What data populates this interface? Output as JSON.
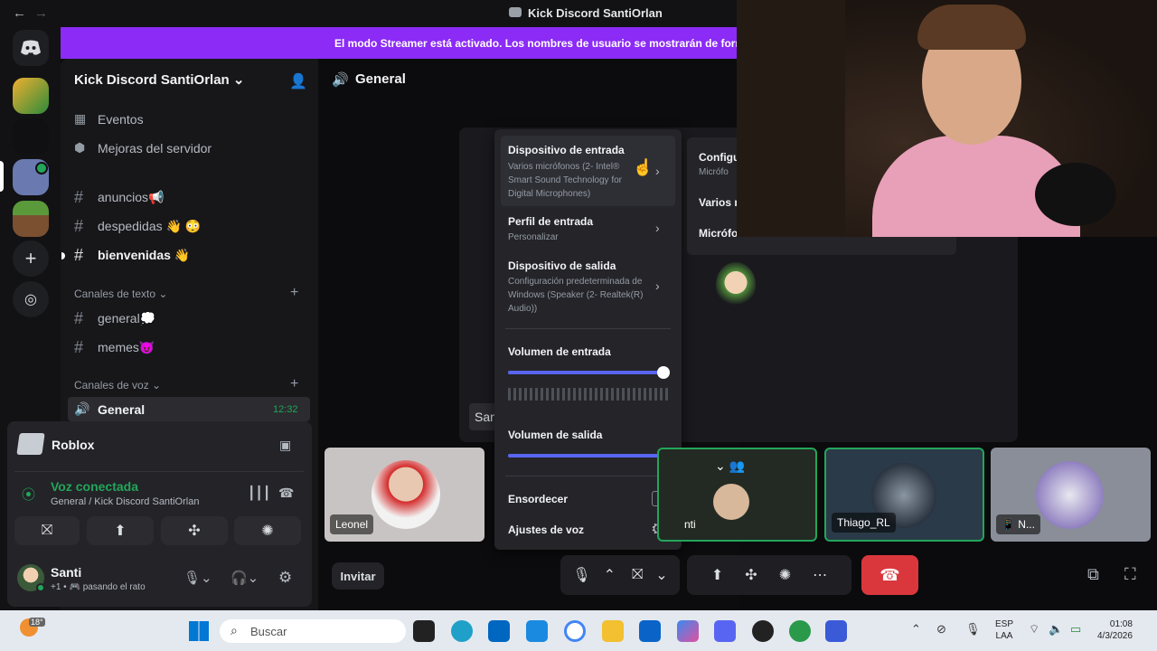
{
  "titlebar": {
    "title": "Kick Discord SantiOrlan",
    "back": "←",
    "forward": "→"
  },
  "banner": {
    "text": "El modo Streamer está activado. Los nombres de usuario se mostrarán de form"
  },
  "server": {
    "name": "Kick Discord SantiOrlan",
    "events": "Eventos",
    "boosts": "Mejoras del servidor"
  },
  "channels": [
    {
      "name": "anuncios📢"
    },
    {
      "name": "despedidas 👋 😳"
    },
    {
      "name": "bienvenidas 👋"
    }
  ],
  "text_category": "Canales de texto",
  "text_channels": [
    {
      "name": "general💭"
    },
    {
      "name": "memes😈"
    }
  ],
  "voice_category": "Canales de voz",
  "voice_channel": {
    "name": "General",
    "time": "12:32"
  },
  "activity": {
    "name": "Roblox"
  },
  "voice_status": {
    "label": "Voz conectada",
    "detail": "General / Kick Discord SantiOrlan"
  },
  "user": {
    "name": "Santi",
    "status": "+1 • 🎮 pasando el rato",
    "plus": "🎮+1 •"
  },
  "main": {
    "title": "General",
    "invite": "Invitar",
    "partial_label": "San"
  },
  "popup": {
    "input_device_title": "Dispositivo de entrada",
    "input_device_value": "Varios micrófonos (2- Intel® Smart Sound Technology for Digital Microphones)",
    "input_profile_title": "Perfil de entrada",
    "input_profile_value": "Personalizar",
    "output_device_title": "Dispositivo de salida",
    "output_device_value": "Configuración predeterminada de Windows (Speaker (2- Realtek(R) Audio))",
    "input_volume": "Volumen de entrada",
    "input_volume_level": 1.0,
    "output_volume": "Volumen de salida",
    "output_volume_level": 1.0,
    "deafen": "Ensordecer",
    "voice_settings": "Ajustes de voz"
  },
  "submenu": {
    "item1": "Configu",
    "item1_sub": "Micrófo",
    "item2": "Varios m",
    "item3": "Micrófo"
  },
  "tiles": [
    {
      "name": "Leonel"
    },
    {
      "name": "nti"
    },
    {
      "name": "Thiago_RL"
    },
    {
      "name": "N..."
    }
  ],
  "taskbar": {
    "search": "Buscar",
    "weather": "18°",
    "lang1": "ESP",
    "lang2": "LAA",
    "time": "01:08",
    "date": "4/3/2026"
  },
  "colors": {
    "accent": "#5865f2",
    "streamer": "#8b2bf5",
    "green": "#23a55a",
    "danger": "#da373c"
  }
}
